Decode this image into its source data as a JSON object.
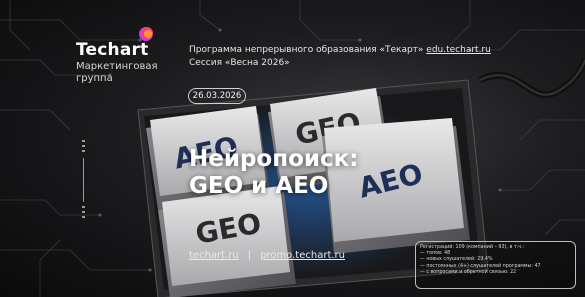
{
  "brand": {
    "name": "Techart",
    "subtitle_line1": "Маркетинговая",
    "subtitle_line2": "группа",
    "accent_colors": [
      "#ff3b6b",
      "#ff9a2e",
      "#b93cff"
    ]
  },
  "program": {
    "line1_prefix": "Программа непрерывного образования «Текарт»",
    "line1_link": "edu.techart.ru",
    "line2": "Сессия «Весна 2026»"
  },
  "date": "26.03.2026",
  "title": {
    "line1": "Нейропоиск:",
    "line2": "GEO и AEO"
  },
  "keys": {
    "top_left": "AEO",
    "top_right": "GEO",
    "bottom_left": "GEO",
    "bottom_right": "AEO"
  },
  "footer": {
    "link1": "techart.ru",
    "separator": "|",
    "link2": "promo.techart.ru"
  },
  "stats": {
    "line1": "Регистраций: 109 (компаний – 93), в т.ч.:",
    "line2": "— топов: 48",
    "line3": "— новых слушателей: 29,4%",
    "line4": "— постоянных (4+) слушателей программы: 47",
    "line5": "— с вопросами и обратной связью: 22"
  }
}
